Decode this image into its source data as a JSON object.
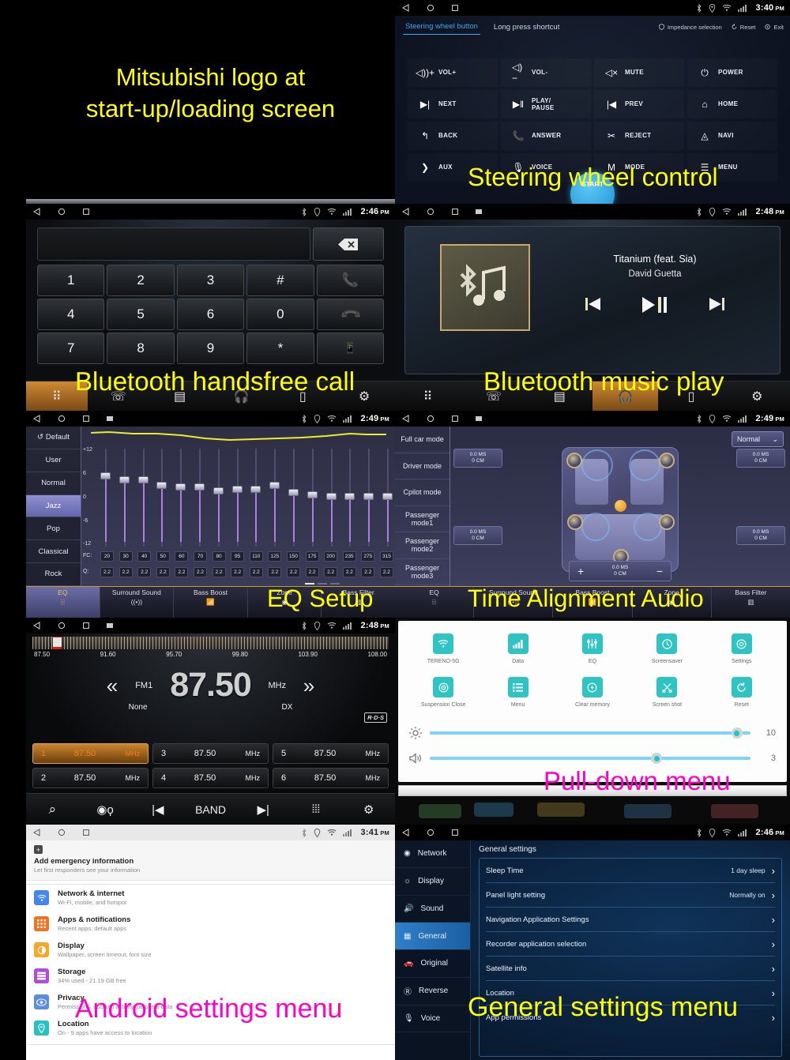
{
  "captions": {
    "splash": [
      "Mitsubishi logo at",
      "start-up/loading screen"
    ],
    "steering": "Steering wheel control",
    "handsfree": "Bluetooth handsfree call",
    "btmusic": "Bluetooth music play",
    "eq": "EQ Setup",
    "timealign": "Time Alignment Audio",
    "pulldown": "Pull-down menu",
    "android": "Android settings menu",
    "general": "General settings menu"
  },
  "statusbar": {
    "icons": [
      "bluetooth-icon",
      "location-icon",
      "wifi-icon",
      "signal-icon"
    ],
    "times": {
      "steering": "3:40",
      "handsfree": "2:46",
      "btmusic": "2:48",
      "eq": "2:49",
      "timealign": "2:49",
      "radio": "2:48",
      "android": "3:41",
      "general": "2:46"
    },
    "ampm": "PM"
  },
  "steering": {
    "tabs": [
      {
        "label": "Steering wheel button",
        "active": true
      },
      {
        "label": "Long press shortcut",
        "active": false
      }
    ],
    "actions": [
      {
        "label": "Impedance selection",
        "icon": "shield-icon"
      },
      {
        "label": "Reset",
        "icon": "refresh-icon"
      },
      {
        "label": "Exit",
        "icon": "exit-icon"
      }
    ],
    "buttons": [
      {
        "label": "VOL+",
        "icon": "volume-up-icon"
      },
      {
        "label": "VOL-",
        "icon": "volume-down-icon"
      },
      {
        "label": "MUTE",
        "icon": "volume-mute-icon"
      },
      {
        "label": "POWER",
        "icon": "power-icon"
      },
      {
        "label": "NEXT",
        "icon": "next-track-icon"
      },
      {
        "label": "PLAY/\nPAUSE",
        "icon": "play-pause-icon"
      },
      {
        "label": "PREV",
        "icon": "prev-track-icon"
      },
      {
        "label": "HOME",
        "icon": "home-icon"
      },
      {
        "label": "BACK",
        "icon": "back-arrow-icon"
      },
      {
        "label": "ANSWER",
        "icon": "phone-answer-icon"
      },
      {
        "label": "REJECT",
        "icon": "phone-reject-icon"
      },
      {
        "label": "NAVI",
        "icon": "navigation-arrow-icon"
      },
      {
        "label": "AUX",
        "icon": "aux-plug-icon"
      },
      {
        "label": "VOICE",
        "icon": "microphone-icon"
      },
      {
        "label": "MODE",
        "icon": "mode-m-icon"
      },
      {
        "label": "MENU",
        "icon": "menu-list-icon"
      }
    ],
    "start_label": "START"
  },
  "dialpad": {
    "input_value": "",
    "keys": [
      "1",
      "2",
      "3",
      "#",
      "call",
      "4",
      "5",
      "6",
      "0",
      "end",
      "7",
      "8",
      "9",
      "*",
      "transfer"
    ],
    "navbar": [
      {
        "icon": "apps-grid-icon",
        "selected": true
      },
      {
        "icon": "call-log-icon",
        "selected": false
      },
      {
        "icon": "contacts-icon",
        "selected": false
      },
      {
        "icon": "bt-audio-icon",
        "selected": false
      },
      {
        "icon": "bt-device-icon",
        "selected": false
      },
      {
        "icon": "bt-settings-icon",
        "selected": false
      }
    ]
  },
  "btmusic": {
    "track": "Titanium (feat. Sia)",
    "artist": "David Guetta",
    "transport": [
      "prev-track-icon",
      "play-pause-icon",
      "next-track-icon"
    ],
    "album_icon": "bluetooth-music-icon",
    "navbar": [
      {
        "icon": "apps-grid-icon",
        "selected": false
      },
      {
        "icon": "call-log-icon",
        "selected": false
      },
      {
        "icon": "contacts-icon",
        "selected": false
      },
      {
        "icon": "bt-audio-icon",
        "selected": true
      },
      {
        "icon": "bt-device-icon",
        "selected": false
      },
      {
        "icon": "bt-settings-icon",
        "selected": false
      }
    ]
  },
  "eq": {
    "presets": [
      {
        "label": "Default",
        "icon": "refresh-icon",
        "active": false
      },
      {
        "label": "User",
        "active": false
      },
      {
        "label": "Normal",
        "active": false
      },
      {
        "label": "Jazz",
        "active": true
      },
      {
        "label": "Pop",
        "active": false
      },
      {
        "label": "Classical",
        "active": false
      },
      {
        "label": "Rock",
        "active": false
      }
    ],
    "y_labels": [
      "+12",
      "6",
      "0",
      "-6",
      "-12"
    ],
    "fc_label": "FC:",
    "q_label": "Q:",
    "fc_values": [
      20,
      30,
      40,
      50,
      60,
      70,
      80,
      95,
      110,
      125,
      150,
      175,
      200,
      235,
      275,
      315
    ],
    "q_values": [
      2.2,
      2.2,
      2.2,
      2.2,
      2.2,
      2.2,
      2.2,
      2.2,
      2.2,
      2.2,
      2.2,
      2.2,
      2.2,
      2.2,
      2.2,
      2.2
    ],
    "gains": [
      5.5,
      4.5,
      4.5,
      3.0,
      2.5,
      2.5,
      1.5,
      2.0,
      2.0,
      3.0,
      1.0,
      0.5,
      0.0,
      0.0,
      0.0,
      0.0
    ],
    "gain_range": [
      -12,
      12
    ],
    "page_dots": [
      true,
      false,
      false
    ]
  },
  "audio_tabs": [
    {
      "label": "EQ",
      "icon": "equalizer-icon",
      "active": true
    },
    {
      "label": "Surround Sound",
      "icon": "surround-icon",
      "active": false
    },
    {
      "label": "Bass Boost",
      "icon": "bass-boost-icon",
      "active": false
    },
    {
      "label": "Zone",
      "icon": "zone-icon",
      "active": false
    },
    {
      "label": "Bass Filter",
      "icon": "bass-filter-icon",
      "active": false
    }
  ],
  "timealign": {
    "modes": [
      "Full car mode",
      "Driver mode",
      "Cpilot mode",
      "Passenger mode1",
      "Passenger mode2",
      "Passenger mode3"
    ],
    "mode_select": "Normal",
    "delay_boxes": [
      {
        "ms": "0.0 MS",
        "cm": "0 CM"
      },
      {
        "ms": "0.0 MS",
        "cm": "0 CM"
      },
      {
        "ms": "0.0 MS",
        "cm": "0 CM"
      },
      {
        "ms": "0.0 MS",
        "cm": "0 CM"
      }
    ],
    "stepper": {
      "ms": "0.0 MS",
      "cm": "0 CM",
      "plus": "+",
      "minus": "−"
    }
  },
  "radio": {
    "scale": [
      "87.50",
      "91.60",
      "95.70",
      "99.80",
      "103.90",
      "108.00"
    ],
    "band": "FM1",
    "frequency": "87.50",
    "unit": "MHz",
    "station_name": "None",
    "sensitivity": "DX",
    "rds": "R·D·S",
    "prev_icon": "rewind-icon",
    "next_icon": "fast-forward-icon",
    "presets": [
      {
        "n": "1",
        "f": "87.50",
        "u": "MHz",
        "active": true
      },
      {
        "n": "3",
        "f": "87.50",
        "u": "MHz",
        "active": false
      },
      {
        "n": "5",
        "f": "87.50",
        "u": "MHz",
        "active": false
      },
      {
        "n": "2",
        "f": "87.50",
        "u": "MHz",
        "active": false
      },
      {
        "n": "4",
        "f": "87.50",
        "u": "MHz",
        "active": false
      },
      {
        "n": "6",
        "f": "87.50",
        "u": "MHz",
        "active": false
      }
    ],
    "toolbar": [
      {
        "icon": "search-icon",
        "label": ""
      },
      {
        "icon": "antenna-scan-icon",
        "label": ""
      },
      {
        "icon": "prev-track-icon",
        "label": ""
      },
      {
        "icon": "",
        "label": "BAND"
      },
      {
        "icon": "next-track-icon",
        "label": ""
      },
      {
        "icon": "equalizer-icon",
        "label": ""
      },
      {
        "icon": "gear-icon",
        "label": ""
      }
    ]
  },
  "pulldown": {
    "tiles": [
      {
        "label": "TERENO-5G",
        "icon": "wifi-icon"
      },
      {
        "label": "Data",
        "icon": "signal-bars-icon"
      },
      {
        "label": "EQ",
        "icon": "equalizer-icon"
      },
      {
        "label": "Screensaver",
        "icon": "clock-icon"
      },
      {
        "label": "Settings",
        "icon": "gear-icon"
      },
      {
        "label": "Suspension Close",
        "icon": "target-icon"
      },
      {
        "label": "Menu",
        "icon": "menu-list-icon"
      },
      {
        "label": "Clear memory",
        "icon": "bolt-icon"
      },
      {
        "label": "Screen shot",
        "icon": "scissors-icon"
      },
      {
        "label": "Reset",
        "icon": "refresh-icon"
      }
    ],
    "brightness": {
      "icon": "brightness-icon",
      "value": "10",
      "percent": 95
    },
    "volume": {
      "icon": "volume-icon",
      "value": "3",
      "percent": 70
    }
  },
  "android_settings": {
    "emergency": {
      "title": "Add emergency information",
      "subtitle": "Let first responders see your information",
      "icon": "plus-badge-icon"
    },
    "items": [
      {
        "title": "Network & internet",
        "subtitle": "Wi-Fi, mobile, and hotspot",
        "icon": "wifi-icon",
        "color": "#4285f4"
      },
      {
        "title": "Apps & notifications",
        "subtitle": "Recent apps, default apps",
        "icon": "apps-grid-icon",
        "color": "#f4711f"
      },
      {
        "title": "Display",
        "subtitle": "Wallpaper, screen timeout, font size",
        "icon": "brightness-icon",
        "color": "#f9a825"
      },
      {
        "title": "Storage",
        "subtitle": "34% used - 21.19 GB free",
        "icon": "storage-icon",
        "color": "#b14ae0"
      },
      {
        "title": "Privacy",
        "subtitle": "Permissions, account activity, personal data",
        "icon": "privacy-icon",
        "color": "#5a8fe0"
      },
      {
        "title": "Location",
        "subtitle": "On - 9 apps have access to location",
        "icon": "location-icon",
        "color": "#27c2c2"
      }
    ]
  },
  "general_settings": {
    "sidebar": [
      {
        "label": "Network",
        "icon": "antenna-icon",
        "active": false
      },
      {
        "label": "Display",
        "icon": "brightness-icon",
        "active": false
      },
      {
        "label": "Sound",
        "icon": "volume-icon",
        "active": false
      },
      {
        "label": "General",
        "icon": "grid-icon",
        "active": true
      },
      {
        "label": "Original",
        "icon": "car-icon",
        "active": false
      },
      {
        "label": "Reverse",
        "icon": "reverse-r-icon",
        "active": false
      },
      {
        "label": "Voice",
        "icon": "microphone-icon",
        "active": false
      }
    ],
    "title": "General settings",
    "rows": [
      {
        "label": "Sleep Time",
        "value": "1 day sleep"
      },
      {
        "label": "Panel light setting",
        "value": "Normally on"
      },
      {
        "label": "Navigation Application Settings",
        "value": ""
      },
      {
        "label": "Recorder application selection",
        "value": ""
      },
      {
        "label": "Satellite info",
        "value": ""
      },
      {
        "label": "Location",
        "value": ""
      },
      {
        "label": "App permissions",
        "value": ""
      }
    ]
  }
}
